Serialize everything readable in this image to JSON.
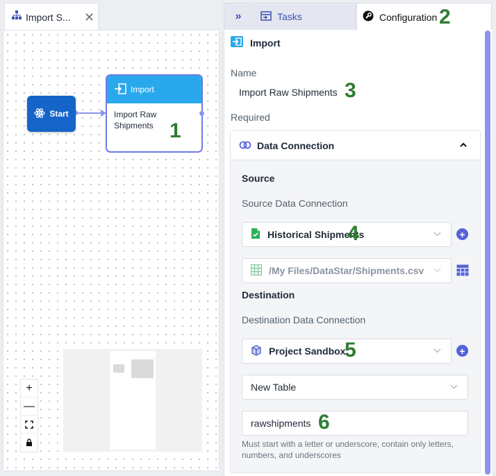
{
  "left": {
    "tab_label": "Import S...",
    "start_label": "Start",
    "node_header": "Import",
    "node_body": "Import Raw Shipments"
  },
  "right": {
    "tabs": {
      "collapse": "»",
      "tasks": "Tasks",
      "configuration": "Configuration"
    },
    "header": "Import",
    "name_label": "Name",
    "name_value": "Import Raw Shipments",
    "required_label": "Required",
    "section_title": "Data Connection",
    "source_heading": "Source",
    "source_conn_label": "Source Data Connection",
    "source_conn_value": "Historical Shipments",
    "source_path_value": "/My Files/DataStar/Shipments.csv",
    "dest_heading": "Destination",
    "dest_conn_label": "Destination Data Connection",
    "dest_conn_value": "Project Sandbox",
    "table_mode_value": "New Table",
    "table_name_value": "rawshipments",
    "table_name_hint": "Must start with a letter or underscore, contain only letters, numbers, and underscores"
  },
  "annotations": [
    "1",
    "2",
    "3",
    "4",
    "5",
    "6"
  ],
  "colors": {
    "accent": "#3f51b5",
    "start_node": "#1565c9",
    "import_header": "#29a9ec",
    "annotation": "#2e7d32"
  }
}
